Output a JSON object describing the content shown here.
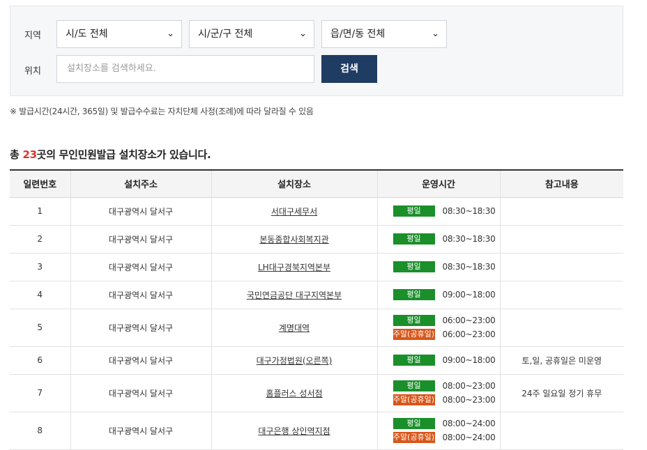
{
  "filter": {
    "region_label": "지역",
    "location_label": "위치",
    "province_select": "시/도 전체",
    "district_select": "시/군/구 전체",
    "town_select": "읍/면/동 전체",
    "search_placeholder": "설치장소를 검색하세요.",
    "search_button": "검색"
  },
  "notice": "※ 발급시간(24시간, 365일) 및 발급수수료는 자치단체 사정(조례)에 따라 달라질 수 있음",
  "summary": {
    "prefix": "총 ",
    "count": "23",
    "suffix": "곳의 무인민원발급 설치장소가 있습니다."
  },
  "table": {
    "headers": [
      "일련번호",
      "설치주소",
      "설치장소",
      "운영시간",
      "참고내용"
    ],
    "rows": [
      {
        "no": "1",
        "address": "대구광역시 달서구",
        "place": "서대구세무서",
        "weekday_badge": "평일",
        "weekday_time": "08:30~18:30",
        "note": ""
      },
      {
        "no": "2",
        "address": "대구광역시 달서구",
        "place": "본동종합사회복지관",
        "weekday_badge": "평일",
        "weekday_time": "08:30~18:30",
        "note": ""
      },
      {
        "no": "3",
        "address": "대구광역시 달서구",
        "place": "LH대구경북지역본부",
        "weekday_badge": "평일",
        "weekday_time": "08:30~18:30",
        "note": ""
      },
      {
        "no": "4",
        "address": "대구광역시 달서구",
        "place": "국민연금공단 대구지역본부",
        "weekday_badge": "평일",
        "weekday_time": "09:00~18:00",
        "note": ""
      },
      {
        "no": "5",
        "address": "대구광역시 달서구",
        "place": "계명대역",
        "weekday_badge": "평일",
        "weekday_time": "06:00~23:00",
        "weekend_badge": "주말(공휴일)",
        "weekend_time": "06:00~23:00",
        "note": ""
      },
      {
        "no": "6",
        "address": "대구광역시 달서구",
        "place": "대구가정법원(오른쪽)",
        "weekday_badge": "평일",
        "weekday_time": "09:00~18:00",
        "note": "토,일, 공휴일은 미운영"
      },
      {
        "no": "7",
        "address": "대구광역시 달서구",
        "place": "홈플러스 성서점",
        "weekday_badge": "평일",
        "weekday_time": "08:00~23:00",
        "weekend_badge": "주말(공휴일)",
        "weekend_time": "08:00~23:00",
        "note": "24주 일요일 정기 휴무"
      },
      {
        "no": "8",
        "address": "대구광역시 달서구",
        "place": "대구은행 상인역지점",
        "weekday_badge": "평일",
        "weekday_time": "08:00~24:00",
        "weekend_badge": "주말(공휴일)",
        "weekend_time": "08:00~24:00",
        "note": ""
      }
    ]
  },
  "colors": {
    "weekday_badge": "#1a8f2a",
    "weekend_badge": "#d95619",
    "search_button": "#1f3c63",
    "count_highlight": "#d9342b"
  },
  "icons": {
    "select_chevron": "chevron-down-icon"
  }
}
